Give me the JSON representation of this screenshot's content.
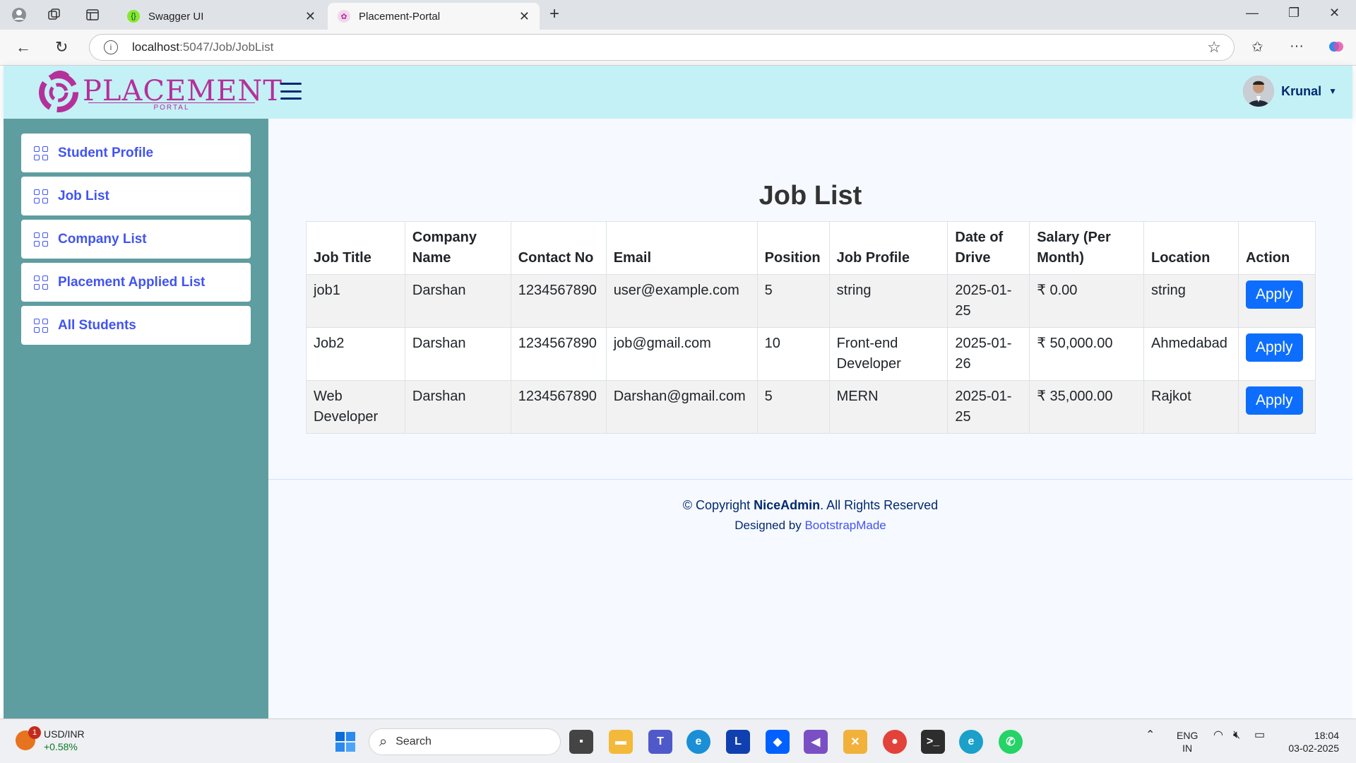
{
  "browser": {
    "tabs": [
      {
        "label": "Swagger UI",
        "close": "✕"
      },
      {
        "label": "Placement-Portal",
        "close": "✕"
      }
    ],
    "url_host": "localhost",
    "url_path": ":5047/Job/JobList"
  },
  "header": {
    "logo_word": "PLACEMENT",
    "logo_sub": "PORTAL",
    "user_name": "Krunal"
  },
  "sidebar": {
    "items": [
      {
        "label": "Student Profile"
      },
      {
        "label": "Job List"
      },
      {
        "label": "Company List"
      },
      {
        "label": "Placement Applied List"
      },
      {
        "label": "All Students"
      }
    ]
  },
  "main": {
    "title": "Job List",
    "table": {
      "headers": [
        "Job Title",
        "Company Name",
        "Contact No",
        "Email",
        "Position",
        "Job Profile",
        "Date of Drive",
        "Salary (Per Month)",
        "Location",
        "Action"
      ],
      "rows": [
        {
          "job_title": "job1",
          "company": "Darshan",
          "contact": "1234567890",
          "email": "user@example.com",
          "position": "5",
          "profile": "string",
          "date": "2025-01-25",
          "salary": "₹ 0.00",
          "location": "string",
          "action": "Apply"
        },
        {
          "job_title": "Job2",
          "company": "Darshan",
          "contact": "1234567890",
          "email": "job@gmail.com",
          "position": "10",
          "profile": "Front-end Developer",
          "date": "2025-01-26",
          "salary": "₹ 50,000.00",
          "location": "Ahmedabad",
          "action": "Apply"
        },
        {
          "job_title": "Web Developer",
          "company": "Darshan",
          "contact": "1234567890",
          "email": "Darshan@gmail.com",
          "position": "5",
          "profile": "MERN",
          "date": "2025-01-25",
          "salary": "₹ 35,000.00",
          "location": "Rajkot",
          "action": "Apply"
        }
      ]
    }
  },
  "footer": {
    "copyright_prefix": "© Copyright ",
    "brand": "NiceAdmin",
    "copyright_suffix": ". All Rights Reserved",
    "designed_by": "Designed by ",
    "designer": "BootstrapMade"
  },
  "taskbar": {
    "widget_badge": "1",
    "widget_title": "USD/INR",
    "widget_change": "+0.58%",
    "search_label": "Search",
    "lang_top": "ENG",
    "lang_bottom": "IN",
    "time": "18:04",
    "date": "03-02-2025"
  },
  "colors": {
    "header_bg": "#c4f1f6",
    "sidebar_bg": "#5f9ea0",
    "accent": "#4154f1",
    "apply_button": "#0d6efd",
    "logo": "#b5309a"
  }
}
